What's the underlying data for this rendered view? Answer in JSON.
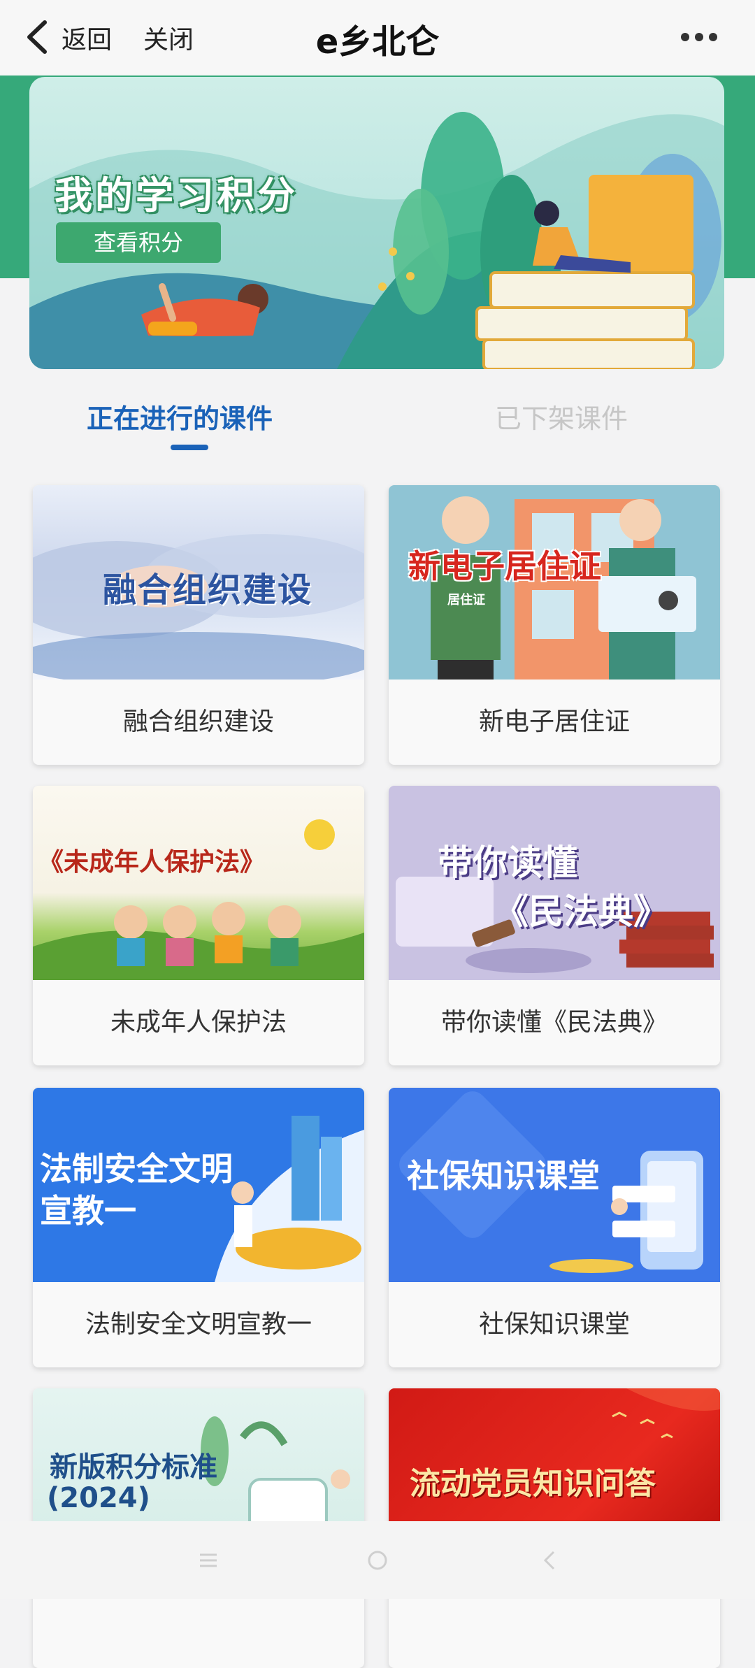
{
  "header": {
    "back_label": "返回",
    "close_label": "关闭",
    "title": "e乡北仑"
  },
  "banner": {
    "title": "我的学习积分",
    "button_label": "查看积分"
  },
  "tabs": [
    {
      "label": "正在进行的课件",
      "active": true
    },
    {
      "label": "已下架课件",
      "active": false
    }
  ],
  "courses": [
    {
      "label": "融合组织建设",
      "thumb_text": "融合组织建设"
    },
    {
      "label": "新电子居住证",
      "thumb_text": "新电子居住证",
      "badge": "居住证"
    },
    {
      "label": "未成年人保护法",
      "thumb_text": "《未成年人保护法》"
    },
    {
      "label": "带你读懂《民法典》",
      "thumb_text_1": "带你读懂",
      "thumb_text_2": "《民法典》"
    },
    {
      "label": "法制安全文明宣教一",
      "thumb_text_1": "法制安全文明",
      "thumb_text_2": "宣教一"
    },
    {
      "label": "社保知识课堂",
      "thumb_text": "社保知识课堂"
    },
    {
      "label": "",
      "thumb_text_1": "新版积分标准",
      "thumb_text_2": "(2024)"
    },
    {
      "label": "",
      "thumb_text": "流动党员知识问答"
    }
  ],
  "colors": {
    "accent": "#1a62b8",
    "banner_green": "#36a97a",
    "inactive_tab": "#c6c6c6"
  },
  "icons": [
    "back-icon",
    "more-icon",
    "menu-icon",
    "home-icon",
    "nav-back-icon"
  ]
}
